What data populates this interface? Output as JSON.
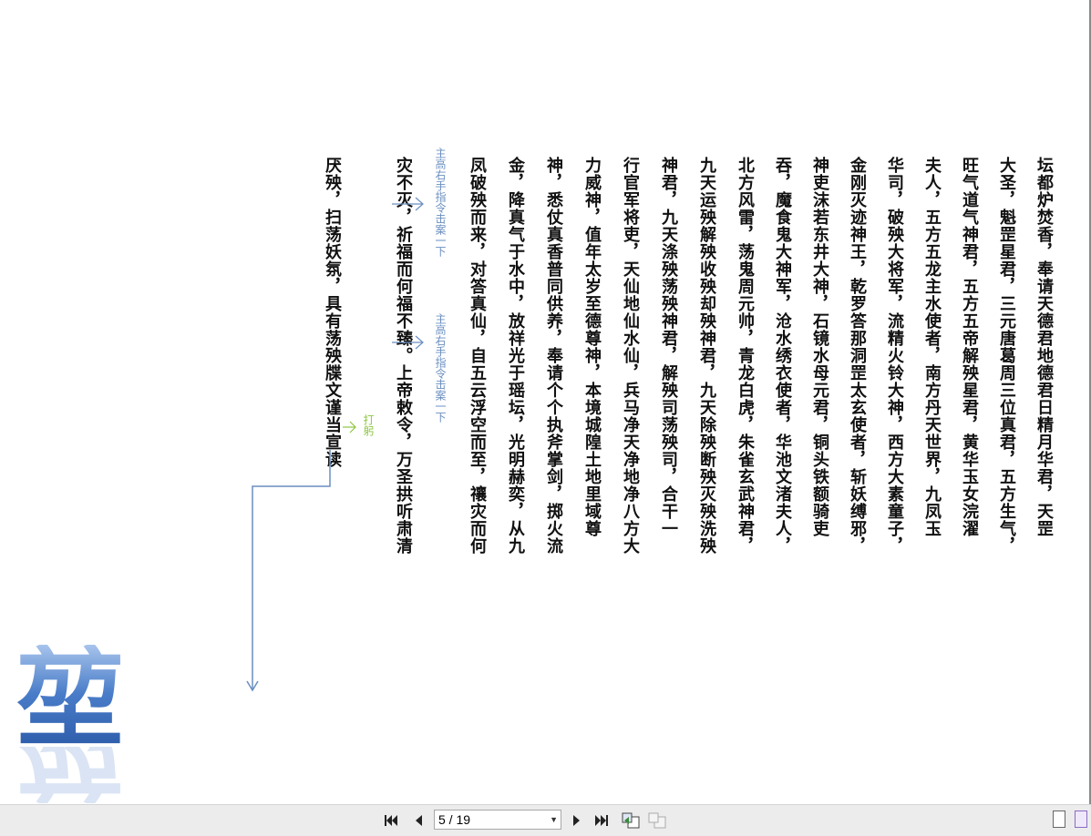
{
  "document": {
    "columns": [
      "坛都炉焚香，奉请天德君地德君日精月华君，天罡",
      "大圣，魁罡星君，三元唐葛周三位真君，五方生气，",
      "旺气道气神君，五方五帝解殃星君，黄华玉女浣濯",
      "夫人，五方五龙主水使者，南方丹天世界，九凤玉",
      "华司，破殃大将军，流精火铃大神，西方大素童子，",
      "金刚灭迹神王，乾罗答那洞罡太玄使者，斩妖缚邪，",
      "神吏沫若东井大神，石镜水母元君，铜头铁额骑吏",
      "吞，魔食鬼大神军，沧水绣衣使者，华池文渚夫人，",
      "北方风雷，荡鬼周元帅，青龙白虎，朱雀玄武神君，",
      "九天运殃解殃收殃却殃神君，九天除殃断殃灭殃洗殃",
      "神君，九天涤殃荡殃神君，解殃司荡殃司，合干一",
      "行官军将吏，天仙地仙水仙，兵马净天净地净八方大",
      "力威神，值年太岁至德尊神，本境城隍土地里域尊",
      "神，悉仗真香普同供养，奉请个个执斧掌剑，掷火流",
      "金，降真气于水中，放祥光于瑶坛，光明赫奕，从九",
      "凤破殃而来，对答真仙，自五云浮空而至，禳灾而何",
      "灾不灭，祈福而何福不臻。上帝敕令，万圣拱听肃清",
      "厌殃，扫荡妖氛，具有荡殃牒文谨当宣读"
    ],
    "notes": [
      "主高右手指令击案一下",
      "主高右手指令击案一下",
      "打躬"
    ],
    "seal_char": "堃"
  },
  "toolbar": {
    "page_value": "5 / 19",
    "icons": [
      "first-page-icon",
      "prev-page-icon",
      "next-page-icon",
      "last-page-icon",
      "go-back-icon",
      "go-forward-icon",
      "single-page-view-icon",
      "continuous-view-icon"
    ]
  },
  "colors": {
    "note_blue": "#6a8fc0",
    "note_green": "#8dc63f",
    "seal_blue": "#3f6fbf",
    "toolbar_bg": "#ececec"
  }
}
